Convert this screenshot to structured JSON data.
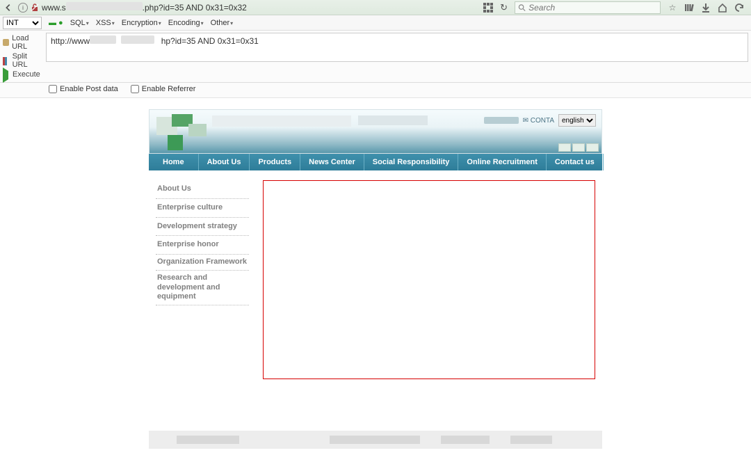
{
  "browser": {
    "url_prefix": "www.s",
    "url_suffix": ".php?id=35 AND 0x31=0x32",
    "search_placeholder": "Search"
  },
  "hackbar": {
    "int_value": "INT",
    "menu": {
      "sql": "SQL",
      "xss": "XSS",
      "encryption": "Encryption",
      "encoding": "Encoding",
      "other": "Other"
    },
    "left": {
      "load": "Load URL",
      "split": "Split URL",
      "execute": "Execute"
    },
    "url_prefix": "http://www",
    "url_suffix": "hp?id=35 AND 0x31=0x31",
    "opts": {
      "post": "Enable Post data",
      "referrer": "Enable Referrer"
    }
  },
  "site": {
    "contact_tag": "CONTA",
    "lang": "english",
    "nav": {
      "home": "Home",
      "about": "About Us",
      "products": "Products",
      "news": "News Center",
      "social": "Social Responsibility",
      "recruit": "Online Recruitment",
      "contact": "Contact us"
    },
    "side": {
      "about": "About Us",
      "culture": "Enterprise culture",
      "strategy": "Development strategy",
      "honor": "Enterprise honor",
      "org": "Organization Framework",
      "rnd": "Research and development and equipment"
    }
  }
}
